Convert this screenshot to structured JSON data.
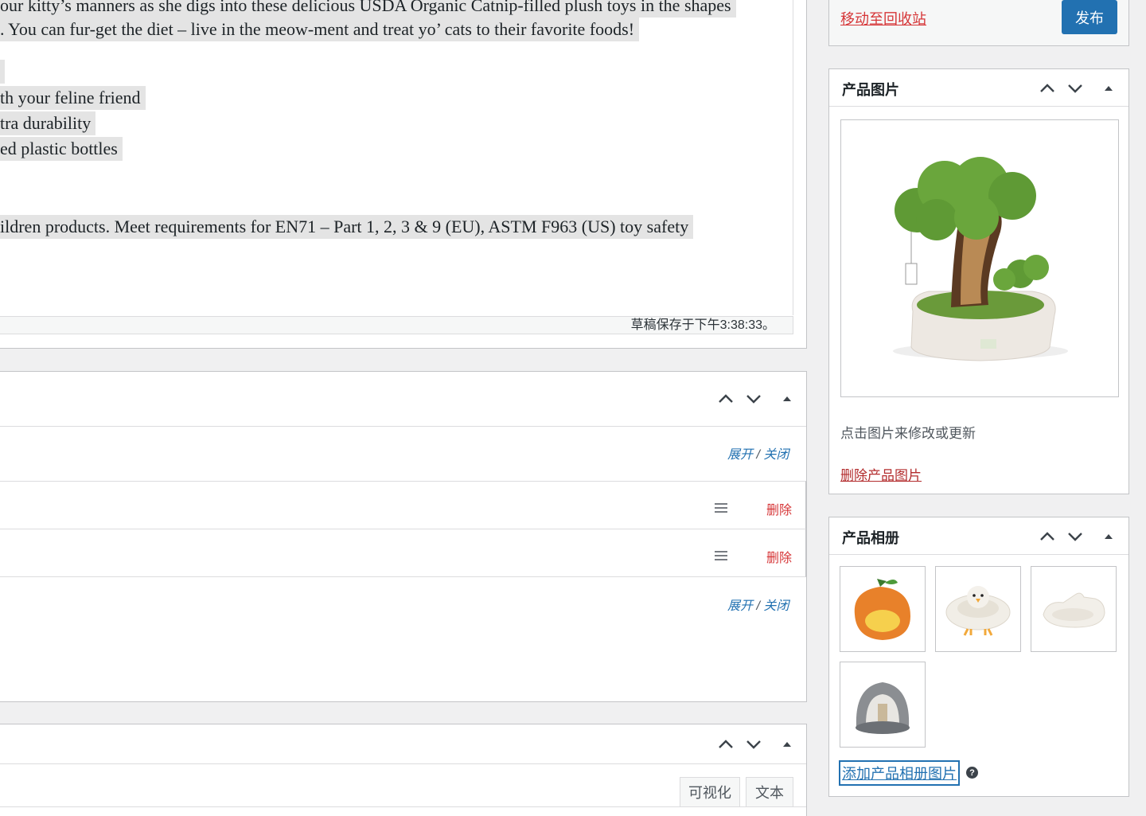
{
  "editor": {
    "lines": [
      "our kitty’s manners as she digs into these delicious USDA Organic Catnip-filled plush toys in the shapes",
      ". You can fur-get the diet – live in the meow-ment and treat yo’ cats to their favorite foods!",
      "th your feline friend",
      "tra durability",
      "ed plastic bottles",
      "ildren products. Meet requirements for EN71 – Part 1, 2, 3 & 9 (EU), ASTM F963 (US) toy safety"
    ],
    "draft_status": "草稿保存于下午3:38:33。"
  },
  "attributes_box": {
    "expand": "展开",
    "separator": " / ",
    "close": "关闭",
    "rows": [
      {
        "delete_label": "删除"
      },
      {
        "delete_label": "删除"
      }
    ]
  },
  "bottom_box": {
    "tab_visual": "可视化",
    "tab_text": "文本"
  },
  "publish": {
    "trash_label": "移动至回收站",
    "publish_label": "发布"
  },
  "product_image": {
    "title": "产品图片",
    "hint": "点击图片来修改或更新",
    "remove_label": "删除产品图片"
  },
  "gallery": {
    "title": "产品相册",
    "add_label": "添加产品相册图片",
    "help_icon": "question-circle-icon",
    "items": [
      "orange-bed-thumbnail",
      "chick-bed-thumbnail",
      "hand-bed-thumbnail",
      "dome-bed-thumbnail"
    ]
  },
  "colors": {
    "accent": "#2271b1",
    "danger": "#d63638",
    "border": "#c3c4c7"
  }
}
